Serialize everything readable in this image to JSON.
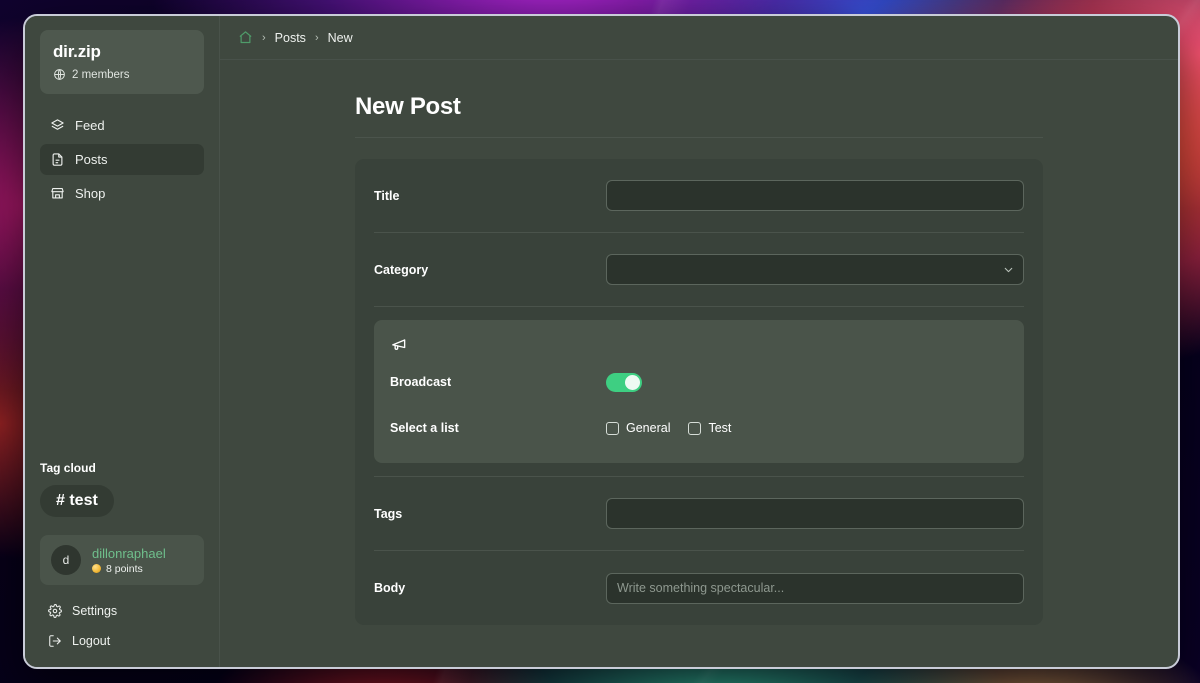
{
  "window": {
    "accent_green": "#3ecf82",
    "username_color": "#6fbf8c",
    "surface": "#3f483f"
  },
  "sidebar": {
    "org": {
      "name": "dir.zip",
      "members": "2 members",
      "globe_icon": "globe-icon"
    },
    "nav": [
      {
        "label": "Feed",
        "icon": "layers-icon",
        "active": false
      },
      {
        "label": "Posts",
        "icon": "document-icon",
        "active": true
      },
      {
        "label": "Shop",
        "icon": "store-icon",
        "active": false
      }
    ],
    "tag_cloud": {
      "title": "Tag cloud",
      "tags": [
        {
          "label": "# test"
        }
      ]
    },
    "user": {
      "avatar_initial": "d",
      "name": "dillonraphael",
      "points": "8 points",
      "coin_icon": "coin-icon"
    },
    "footer": [
      {
        "label": "Settings",
        "icon": "gear-icon"
      },
      {
        "label": "Logout",
        "icon": "logout-icon"
      }
    ]
  },
  "breadcrumb": {
    "home_icon": "home-icon",
    "separator": "›",
    "items": [
      {
        "label": "Posts"
      },
      {
        "label": "New"
      }
    ]
  },
  "page": {
    "title": "New Post"
  },
  "form": {
    "title_field": {
      "label": "Title",
      "value": "",
      "placeholder": ""
    },
    "category_field": {
      "label": "Category",
      "value": "",
      "chevron_icon": "chevron-down-icon"
    },
    "broadcast": {
      "icon": "megaphone-icon",
      "toggle_label": "Broadcast",
      "toggle_on": true,
      "list_label": "Select a list",
      "lists": [
        {
          "label": "General",
          "checked": false
        },
        {
          "label": "Test",
          "checked": false
        }
      ]
    },
    "tags_field": {
      "label": "Tags",
      "value": "",
      "placeholder": ""
    },
    "body_field": {
      "label": "Body",
      "value": "",
      "placeholder": "Write something spectacular..."
    }
  }
}
